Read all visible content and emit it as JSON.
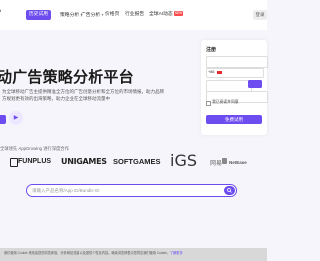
{
  "header": {
    "logo": "g°",
    "nav": [
      {
        "label": "历史试用",
        "active": true
      },
      {
        "label": "策略分析",
        "has_menu": true
      },
      {
        "label": "广告分析",
        "has_menu": true
      },
      {
        "label": "价格页"
      },
      {
        "label": "行业报告"
      },
      {
        "label": "全球AI动态",
        "badge": "NEW"
      }
    ],
    "right_button": "登录"
  },
  "hero": {
    "title": "动广告策略分析平台",
    "description": "为全球移动广告主提供精准全方位的广告创意分析和全方位的市场情报，助力品牌方规划更有效的出海策略，助力企业在全球移动流量中"
  },
  "signup": {
    "title": "注册",
    "email_placeholder": "",
    "country_code": "+86",
    "phone_placeholder": "",
    "code_placeholder": "",
    "password_placeholder": "",
    "agree_label": "我已阅读并同意",
    "submit_label": "免费试用"
  },
  "trust_line": "全球领先 AppGrowing 进行深度合作",
  "brands": {
    "funplus": "FUNPLUS",
    "unigames": "UNIGAMES",
    "softgames": "SOFTGAMES",
    "igs": "iGS",
    "netease_cn": "网易",
    "netease": "NetEase"
  },
  "search": {
    "placeholder": "请输入产品名称/App ID/Bundle ID"
  },
  "cookie": {
    "text": "我们使用 Cookie 来改善您的浏览体验、分析网站流量以及提供个性化内容。继续浏览即表示您同意我们使用 Cookie，",
    "link": "了解更多"
  },
  "colors": {
    "accent": "#6d4cf0",
    "background": "#f6f5fb"
  }
}
